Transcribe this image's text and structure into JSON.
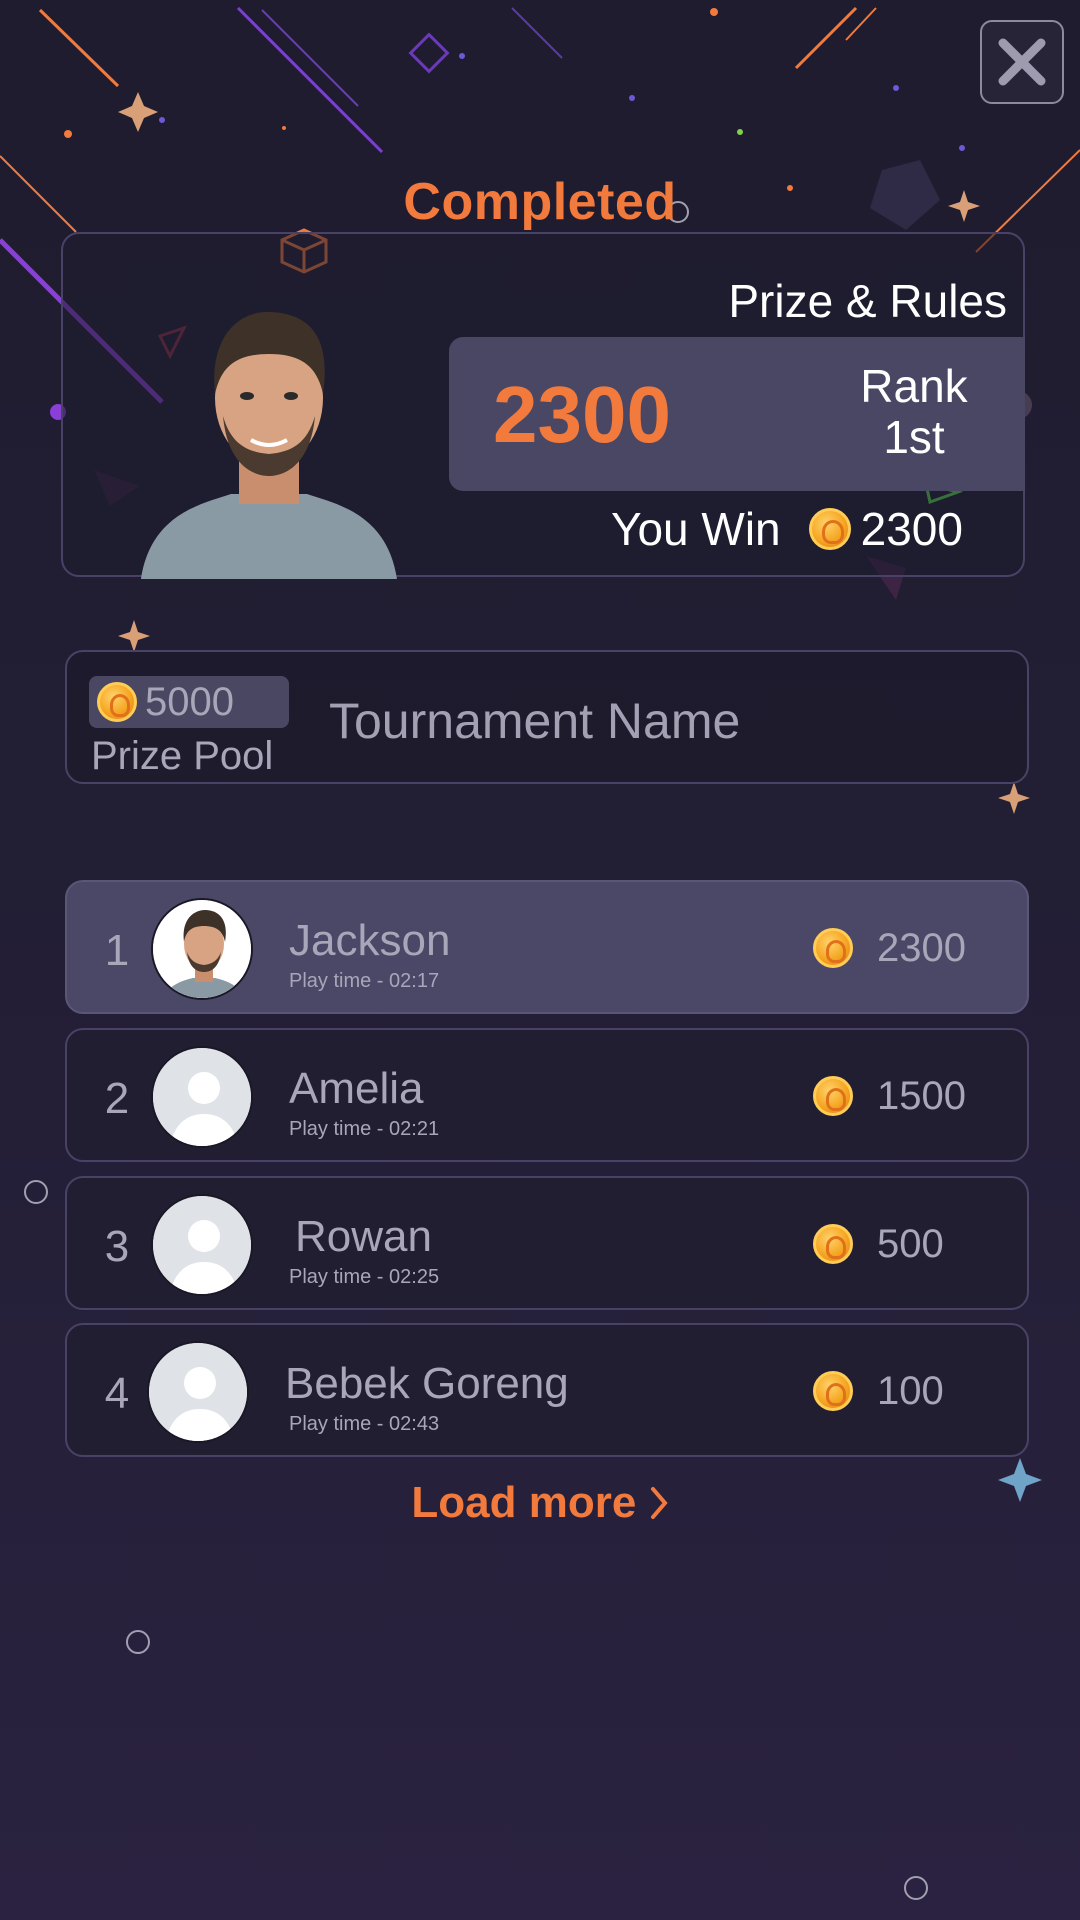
{
  "header": {
    "title": "Completed",
    "close_icon": "close-icon"
  },
  "result": {
    "prize_rules_label": "Prize & Rules",
    "score": "2300",
    "rank_label": "Rank",
    "rank_value": "1st",
    "you_win_label": "You Win",
    "you_win_amount": "2300"
  },
  "tournament": {
    "prize_pool_amount": "5000",
    "prize_pool_label": "Prize Pool",
    "name": "Tournament Name"
  },
  "leaderboard": [
    {
      "rank": "1",
      "name": "Jackson",
      "playtime": "Play time - 02:17",
      "amount": "2300",
      "avatar": "photo"
    },
    {
      "rank": "2",
      "name": "Amelia",
      "playtime": "Play time - 02:21",
      "amount": "1500",
      "avatar": "placeholder"
    },
    {
      "rank": "3",
      "name": "Rowan",
      "playtime": "Play time - 02:25",
      "amount": "500",
      "avatar": "placeholder"
    },
    {
      "rank": "4",
      "name": "Bebek Goreng",
      "playtime": "Play time - 02:43",
      "amount": "100",
      "avatar": "placeholder"
    }
  ],
  "footer": {
    "load_more_label": "Load more"
  },
  "colors": {
    "accent": "#f27a3c",
    "background": "#221e34",
    "panel": "#494763",
    "muted_text": "#a9a6b9",
    "coin": "#f5a623"
  }
}
